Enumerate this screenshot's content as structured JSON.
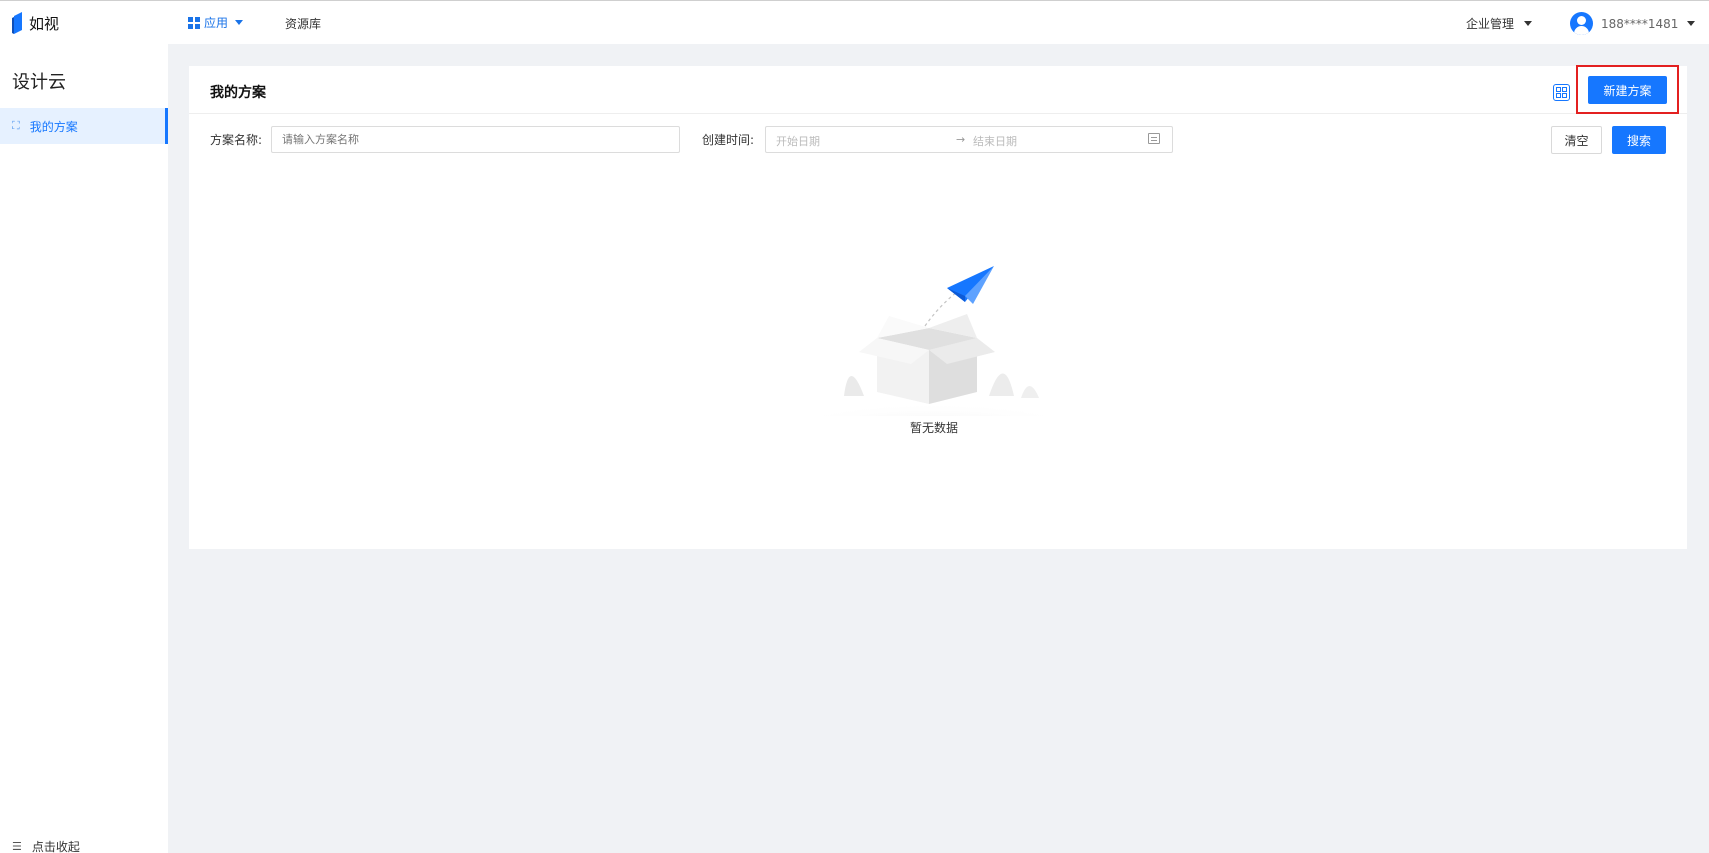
{
  "brand": {
    "name": "如视",
    "color": "#1677ff"
  },
  "topnav": {
    "app_label": "应用",
    "resources_label": "资源库",
    "enterprise_label": "企业管理",
    "user_phone": "188****1481"
  },
  "sidebar": {
    "title": "设计云",
    "items": [
      {
        "label": "我的方案",
        "icon": "cube-icon",
        "active": true
      }
    ],
    "collapse_label": "点击收起"
  },
  "main": {
    "title": "我的方案",
    "new_button": "新建方案",
    "filters": {
      "name_label": "方案名称:",
      "name_placeholder": "请输入方案名称",
      "time_label": "创建时间:",
      "start_placeholder": "开始日期",
      "arrow": "→",
      "end_placeholder": "结束日期"
    },
    "clear_button": "清空",
    "search_button": "搜索",
    "empty_text": "暂无数据"
  },
  "colors": {
    "accent": "#1677ff",
    "highlight": "#e32020",
    "background": "#f0f2f5"
  }
}
